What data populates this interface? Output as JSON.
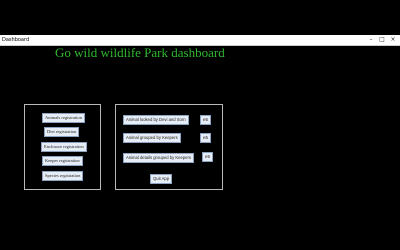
{
  "window": {
    "title": "Dashboard"
  },
  "header": {
    "title": "Go wild wildlife Park dashboard",
    "title_color": "#2fb82f"
  },
  "registration_panel": {
    "buttons": [
      {
        "label": "Animals registration"
      },
      {
        "label": "Diet registration"
      },
      {
        "label": "Enclosure registration"
      },
      {
        "label": "Keeper registration"
      },
      {
        "label": "Species registration"
      }
    ]
  },
  "reports_panel": {
    "rows": [
      {
        "label": "Animal looked by Devi and Sorn",
        "count": "e5"
      },
      {
        "label": "Animal grouped by Keepers",
        "count": "e5"
      },
      {
        "label": "Animal details grouped by Keepers",
        "count": "e5"
      }
    ],
    "quit_label": "Quit App"
  }
}
